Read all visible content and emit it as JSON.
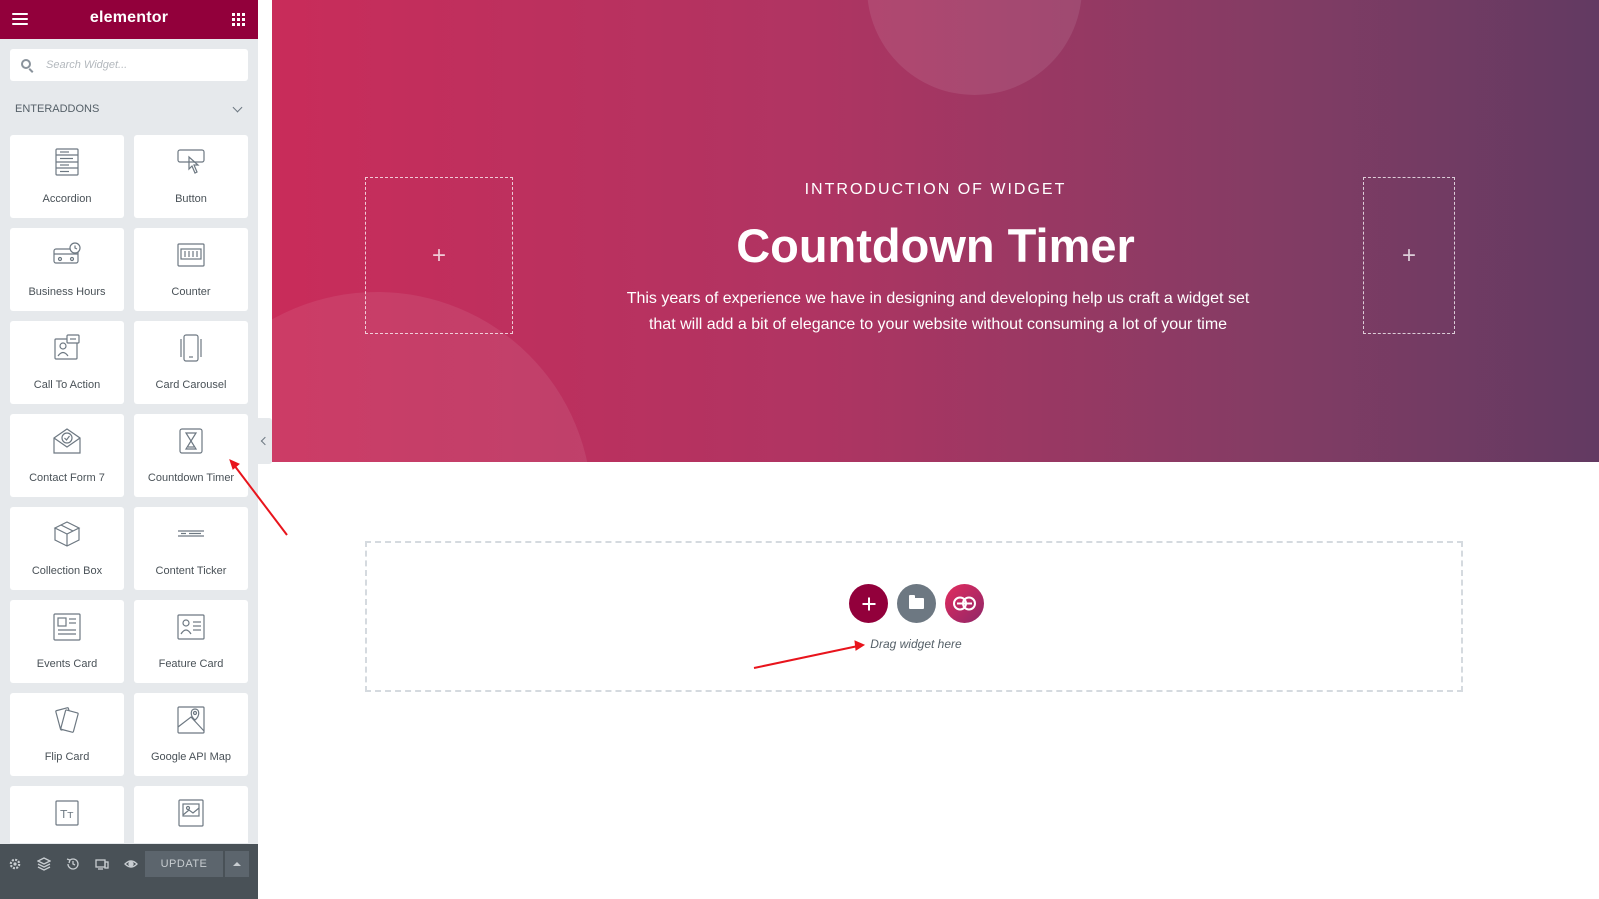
{
  "panel": {
    "logo": "elementor",
    "search_placeholder": "Search Widget...",
    "category": "ENTERADDONS",
    "widgets": [
      {
        "label": "Accordion",
        "icon": "accordion-icon"
      },
      {
        "label": "Button",
        "icon": "button-icon"
      },
      {
        "label": "Business Hours",
        "icon": "business-hours-icon"
      },
      {
        "label": "Counter",
        "icon": "counter-icon"
      },
      {
        "label": "Call To Action",
        "icon": "call-to-action-icon"
      },
      {
        "label": "Card Carousel",
        "icon": "card-carousel-icon"
      },
      {
        "label": "Contact Form 7",
        "icon": "contact-form-icon"
      },
      {
        "label": "Countdown Timer",
        "icon": "countdown-timer-icon"
      },
      {
        "label": "Collection Box",
        "icon": "collection-box-icon"
      },
      {
        "label": "Content Ticker",
        "icon": "content-ticker-icon"
      },
      {
        "label": "Events Card",
        "icon": "events-card-icon"
      },
      {
        "label": "Feature Card",
        "icon": "feature-card-icon"
      },
      {
        "label": "Flip Card",
        "icon": "flip-card-icon"
      },
      {
        "label": "Google API Map",
        "icon": "google-map-icon"
      },
      {
        "label": "",
        "icon": "text-icon"
      },
      {
        "label": "",
        "icon": "image-icon"
      }
    ],
    "footer": {
      "update_label": "UPDATE",
      "icons": [
        "settings-icon",
        "navigator-icon",
        "history-icon",
        "responsive-icon",
        "preview-icon"
      ]
    }
  },
  "hero": {
    "subtitle": "INTRODUCTION OF WIDGET",
    "title": "Countdown Timer",
    "description": "This years of experience we have in designing and developing help us craft a widget set that will add a bit of elegance to your website without consuming a lot of your time",
    "placeholder_plus": "+"
  },
  "drop_zone": {
    "text": "Drag widget here"
  },
  "colors": {
    "brand": "#92003b",
    "panel_bg": "#e6e9ec",
    "footer_bg": "#495157",
    "annotation": "#e8141c"
  }
}
